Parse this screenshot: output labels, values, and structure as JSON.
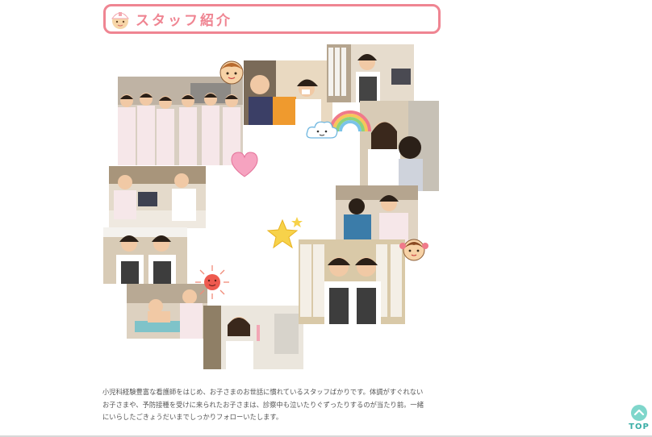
{
  "section": {
    "title": "スタッフ紹介"
  },
  "description": "小児科経験豊富な看護師をはじめ、お子さまのお世話に慣れているスタッフばかりです。体調がすぐれないお子さまや、予防接種を受けに来られたお子さまは、診察中も泣いたりぐずったりするのが当たり前。一緒にいらしたごきょうだいまでしっかりフォローいたします。",
  "top_button": {
    "label": "TOP"
  },
  "colors": {
    "accent": "#ef8592",
    "top_button": "#7fd6cb",
    "text": "#555555"
  },
  "decorations": [
    "boy-face-icon",
    "cloud-icon",
    "rainbow-icon",
    "heart-icon",
    "star-icon",
    "girl-face-icon",
    "sun-icon",
    "nurse-icon"
  ]
}
